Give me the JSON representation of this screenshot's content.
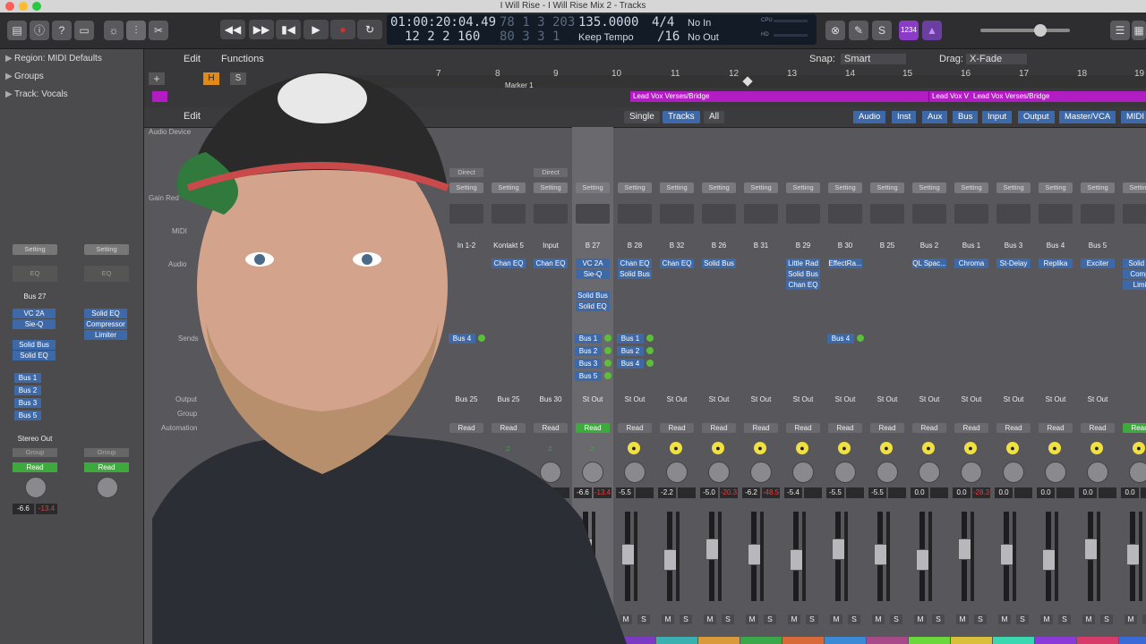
{
  "window": {
    "title": "I Will Rise - I Will Rise Mix 2 - Tracks"
  },
  "lcd": {
    "position_time": "01:00:20:04.49",
    "position_bars": "12  2  2  160",
    "end_top": "78  1  3  203",
    "end_bottom": "80  3  3     1",
    "tempo": "135.0000",
    "tempo_mode": "Keep Tempo",
    "signature_top": "4/4",
    "signature_bottom": "/16",
    "in_label": "No In",
    "out_label": "No Out",
    "cpu_label": "CPU",
    "hd_label": "HD"
  },
  "toolbar": {
    "badge": "1234"
  },
  "inspector": {
    "region_label": "Region:",
    "region_value": "MIDI Defaults",
    "groups": "Groups",
    "track_label": "Track:",
    "track_value": "Vocals",
    "strip1": {
      "setting": "Setting",
      "eq": "EQ",
      "input": "Bus 27",
      "plugins": [
        "VC 2A",
        "Sie-Q"
      ],
      "plugins2": [
        "Solid Bus",
        "Solid EQ"
      ],
      "sends": [
        "Bus 1",
        "Bus 2",
        "Bus 3",
        "Bus 5"
      ],
      "output": "Stereo Out",
      "group": "Group",
      "auto": "Read",
      "vol": "-6.6",
      "pan": "-13.4"
    },
    "strip2": {
      "setting": "Setting",
      "eq": "EQ",
      "plugins": [
        "Solid EQ",
        "Compressor",
        "Limiter"
      ],
      "group": "Group",
      "auto": "Read"
    }
  },
  "tracks_menu": {
    "edit": "Edit",
    "functions": "Functions",
    "snap_label": "Snap:",
    "snap_value": "Smart",
    "drag_label": "Drag:",
    "drag_value": "X-Fade",
    "marker": "Marker 1"
  },
  "ruler": [
    "7",
    "8",
    "9",
    "10",
    "11",
    "12",
    "13",
    "14",
    "15",
    "16",
    "17",
    "18",
    "19"
  ],
  "regions": [
    "Lead Vox Verses/Bridge",
    "Lead Vox V",
    "Lead Vox Verses/Bridge"
  ],
  "mixer": {
    "edit": "Edit",
    "views": [
      "Single",
      "Tracks",
      "All"
    ],
    "filters": [
      "Audio",
      "Inst",
      "Aux",
      "Bus",
      "Input",
      "Output",
      "Master/VCA",
      "MIDI"
    ],
    "row_labels": [
      "Audio Device",
      "Gain Red",
      "MIDI",
      "Audio",
      "Sends",
      "Output",
      "Group",
      "Automation"
    ],
    "strips": [
      {
        "input": "In 1-2",
        "setting": "Setting",
        "plugins": [],
        "sends": [
          "Bus 4"
        ],
        "output": "Bus 25",
        "auto": "Read",
        "vol": "",
        "pan": ""
      },
      {
        "input": "Kontakt 5",
        "setting": "Setting",
        "plugins": [
          "Chan EQ"
        ],
        "sends": [],
        "output": "Bus 25",
        "auto": "Read",
        "vol": "",
        "pan": ""
      },
      {
        "input": "Input",
        "setting": "Setting",
        "plugins": [
          "Chan EQ"
        ],
        "sends": [],
        "output": "Bus 30",
        "auto": "Read",
        "vol": "-9.2",
        "pan": ""
      },
      {
        "input": "B 27",
        "setting": "Setting",
        "plugins": [
          "VC 2A",
          "Sie-Q",
          "Solid Bus",
          "Solid EQ"
        ],
        "sends": [
          "Bus 1",
          "Bus 2",
          "Bus 3",
          "Bus 5"
        ],
        "output": "St Out",
        "auto": "Read",
        "vol": "-6.6",
        "pan": "-13.4"
      },
      {
        "input": "B 28",
        "setting": "Setting",
        "plugins": [
          "Chan EQ",
          "Solid Bus"
        ],
        "sends": [
          "Bus 1",
          "Bus 2",
          "Bus 4"
        ],
        "output": "St Out",
        "auto": "Read",
        "vol": "-5.5",
        "pan": ""
      },
      {
        "input": "B 32",
        "setting": "Setting",
        "plugins": [
          "Chan EQ"
        ],
        "sends": [],
        "output": "St Out",
        "auto": "Read",
        "vol": "-2.2",
        "pan": ""
      },
      {
        "input": "B 26",
        "setting": "Setting",
        "plugins": [
          "Solid Bus"
        ],
        "sends": [],
        "output": "St Out",
        "auto": "Read",
        "vol": "-5.0",
        "pan": "-20.3"
      },
      {
        "input": "B 31",
        "setting": "Setting",
        "plugins": [],
        "sends": [],
        "output": "St Out",
        "auto": "Read",
        "vol": "-6.2",
        "pan": "-48.5"
      },
      {
        "input": "B 29",
        "setting": "Setting",
        "plugins": [
          "Little Rad",
          "Solid Bus",
          "Chan EQ"
        ],
        "sends": [],
        "output": "St Out",
        "auto": "Read",
        "vol": "-5.4",
        "pan": ""
      },
      {
        "input": "B 30",
        "setting": "Setting",
        "plugins": [
          "EffectRa..."
        ],
        "sends": [
          "Bus 4"
        ],
        "output": "St Out",
        "auto": "Read",
        "vol": "-5.5",
        "pan": ""
      },
      {
        "input": "B 25",
        "setting": "Setting",
        "plugins": [],
        "sends": [],
        "output": "St Out",
        "auto": "Read",
        "vol": "-5.5",
        "pan": ""
      },
      {
        "input": "Bus 2",
        "setting": "Setting",
        "plugins": [
          "QL Spac..."
        ],
        "sends": [],
        "output": "St Out",
        "auto": "Read",
        "vol": "0.0",
        "pan": ""
      },
      {
        "input": "Bus 1",
        "setting": "Setting",
        "plugins": [
          "Chroma"
        ],
        "sends": [],
        "output": "St Out",
        "auto": "Read",
        "vol": "0.0",
        "pan": "-28.3"
      },
      {
        "input": "Bus 3",
        "setting": "Setting",
        "plugins": [
          "St-Delay"
        ],
        "sends": [],
        "output": "St Out",
        "auto": "Read",
        "vol": "0.0",
        "pan": ""
      },
      {
        "input": "Bus 4",
        "setting": "Setting",
        "plugins": [
          "Replika"
        ],
        "sends": [],
        "output": "St Out",
        "auto": "Read",
        "vol": "0.0",
        "pan": ""
      },
      {
        "input": "Bus 5",
        "setting": "Setting",
        "plugins": [
          "Exciter"
        ],
        "sends": [],
        "output": "St Out",
        "auto": "Read",
        "vol": "0.0",
        "pan": ""
      },
      {
        "input": "",
        "setting": "Setting",
        "plugins": [
          "Solid B",
          "Comp",
          "Limi"
        ],
        "sends": [],
        "output": "",
        "auto": "Read",
        "vol": "0.0",
        "pan": ""
      }
    ],
    "direct_label": "Direct",
    "m": "M",
    "s": "S"
  }
}
